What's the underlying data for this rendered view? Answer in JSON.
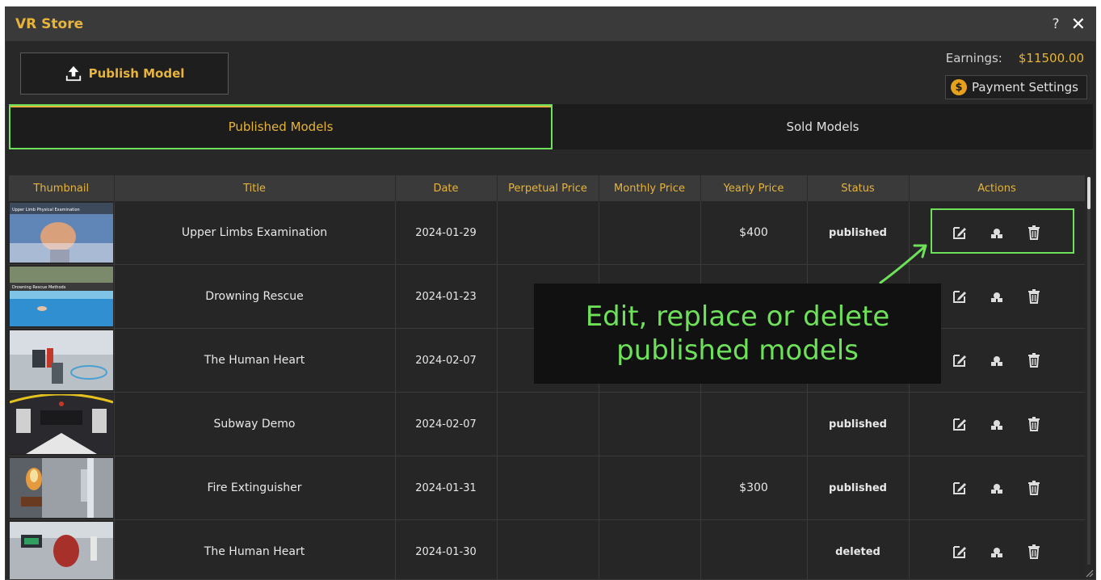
{
  "window": {
    "title": "VR Store",
    "help": "?",
    "close": "✕"
  },
  "toolbar": {
    "publish_label": "Publish Model",
    "publish_icon": "upload-icon"
  },
  "earnings": {
    "label": "Earnings:",
    "value": "$11500.00"
  },
  "payment": {
    "label": "Payment Settings",
    "icon": "dollar-coin-icon",
    "coin_glyph": "$"
  },
  "tabs": [
    {
      "label": "Published Models",
      "active": true
    },
    {
      "label": "Sold Models",
      "active": false
    }
  ],
  "table": {
    "columns": [
      "Thumbnail",
      "Title",
      "Date",
      "Perpetual Price",
      "Monthly Price",
      "Yearly Price",
      "Status",
      "Actions"
    ],
    "rows": [
      {
        "thumb_caption": "Upper Limb Physical Examination",
        "title": "Upper Limbs Examination",
        "date": "2024-01-29",
        "perpetual": "",
        "monthly": "",
        "yearly": "$400",
        "status": "published"
      },
      {
        "thumb_caption": "Drowning Rescue Methods",
        "title": "Drowning Rescue",
        "date": "2024-01-23",
        "perpetual": "",
        "monthly": "",
        "yearly": "",
        "status": ""
      },
      {
        "thumb_caption": "",
        "title": "The Human Heart",
        "date": "2024-02-07",
        "perpetual": "",
        "monthly": "",
        "yearly": "",
        "status": ""
      },
      {
        "thumb_caption": "",
        "title": "Subway Demo",
        "date": "2024-02-07",
        "perpetual": "",
        "monthly": "",
        "yearly": "",
        "status": "published"
      },
      {
        "thumb_caption": "",
        "title": "Fire Extinguisher",
        "date": "2024-01-31",
        "perpetual": "",
        "monthly": "",
        "yearly": "$300",
        "status": "published"
      },
      {
        "thumb_caption": "",
        "title": "The Human Heart",
        "date": "2024-01-30",
        "perpetual": "",
        "monthly": "",
        "yearly": "",
        "status": "deleted"
      }
    ]
  },
  "callout": {
    "line1": "Edit, replace or delete",
    "line2": "published models"
  },
  "colors": {
    "accent": "#e6b43a",
    "highlight": "#6ee05a",
    "background": "#282828"
  }
}
